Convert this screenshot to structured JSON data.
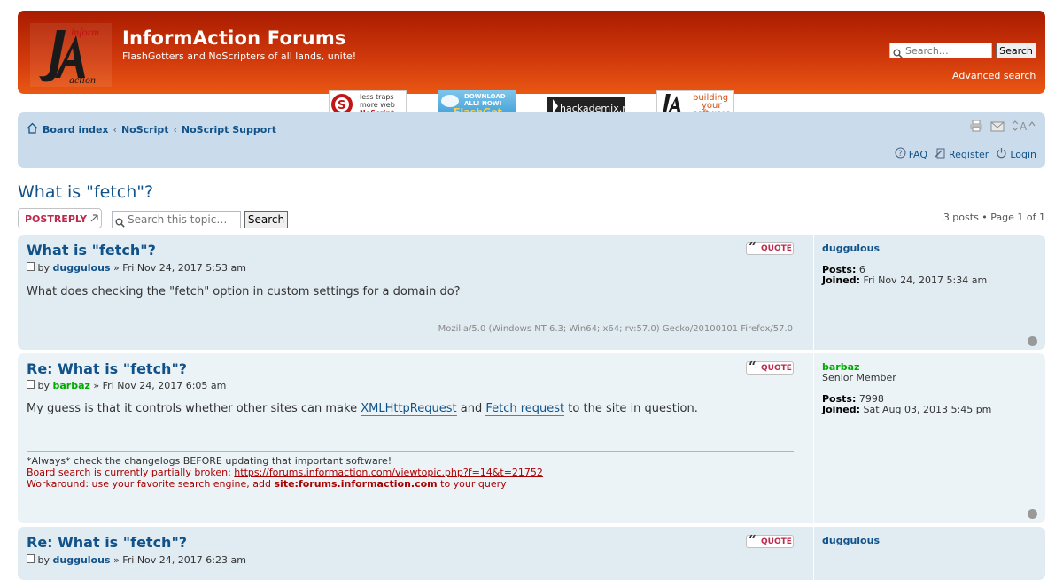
{
  "header": {
    "site_title": "InformAction Forums",
    "site_desc": "FlashGotters and NoScripters of all lands, unite!",
    "search_placeholder": "Search…",
    "search_button": "Search",
    "advanced_search": "Advanced search",
    "logo_text_top": "inform",
    "logo_text_bottom": "action"
  },
  "banners": [
    {
      "line1": "less traps",
      "line2": "more web",
      "line3": "NoScript"
    },
    {
      "line1": "DOWNLOAD",
      "line2": "ALL! NOW!",
      "line3": "FlashGot"
    },
    {
      "line1": "hackademix.net"
    },
    {
      "line1": "building",
      "line2": "your",
      "line3": "software"
    }
  ],
  "nav": {
    "breadcrumbs": [
      "Board index",
      "NoScript",
      "NoScript Support"
    ],
    "sep": "‹",
    "faq": "FAQ",
    "register": "Register",
    "login": "Login",
    "fontsize": "A"
  },
  "topic": {
    "title": "What is \"fetch\"?",
    "post_reply": "POSTREPLY",
    "search_placeholder": "Search this topic…",
    "search_button": "Search",
    "pagination": "3 posts • Page 1 of 1"
  },
  "posts": [
    {
      "title": "What is \"fetch\"?",
      "by": "by",
      "author": "duggulous",
      "date": "» Fri Nov 24, 2017 5:53 am",
      "content": "What does checking the \"fetch\" option in custom settings for a domain do?",
      "user_agent": "Mozilla/5.0 (Windows NT 6.3; Win64; x64; rv:57.0) Gecko/20100101 Firefox/57.0",
      "quote": "QUOTE",
      "profile": {
        "name": "duggulous",
        "posts_label": "Posts:",
        "posts": "6",
        "joined_label": "Joined:",
        "joined": "Fri Nov 24, 2017 5:34 am"
      }
    },
    {
      "title": "Re: What is \"fetch\"?",
      "by": "by",
      "author": "barbaz",
      "date": "» Fri Nov 24, 2017 6:05 am",
      "content_pre": "My guess is that it controls whether other sites can make ",
      "link1": "XMLHttpRequest",
      "content_mid": " and ",
      "link2": "Fetch request",
      "content_post": " to the site in question.",
      "quote": "QUOTE",
      "sig_line1": "*Always* check the changelogs BEFORE updating that important software!",
      "sig_line2_pre": "Board search is currently partially broken: ",
      "sig_line2_link": "https://forums.informaction.com/viewtopic.php?f=14&t=21752",
      "sig_line3_pre": "Workaround: use your favorite search engine, add ",
      "sig_line3_bold": "site:forums.informaction.com",
      "sig_line3_post": " to your query",
      "profile": {
        "name": "barbaz",
        "rank": "Senior Member",
        "posts_label": "Posts:",
        "posts": "7998",
        "joined_label": "Joined:",
        "joined": "Sat Aug 03, 2013 5:45 pm"
      }
    },
    {
      "title": "Re: What is \"fetch\"?",
      "by": "by",
      "author": "duggulous",
      "date": "» Fri Nov 24, 2017 6:23 am",
      "quote": "QUOTE",
      "profile": {
        "name": "duggulous"
      }
    }
  ]
}
